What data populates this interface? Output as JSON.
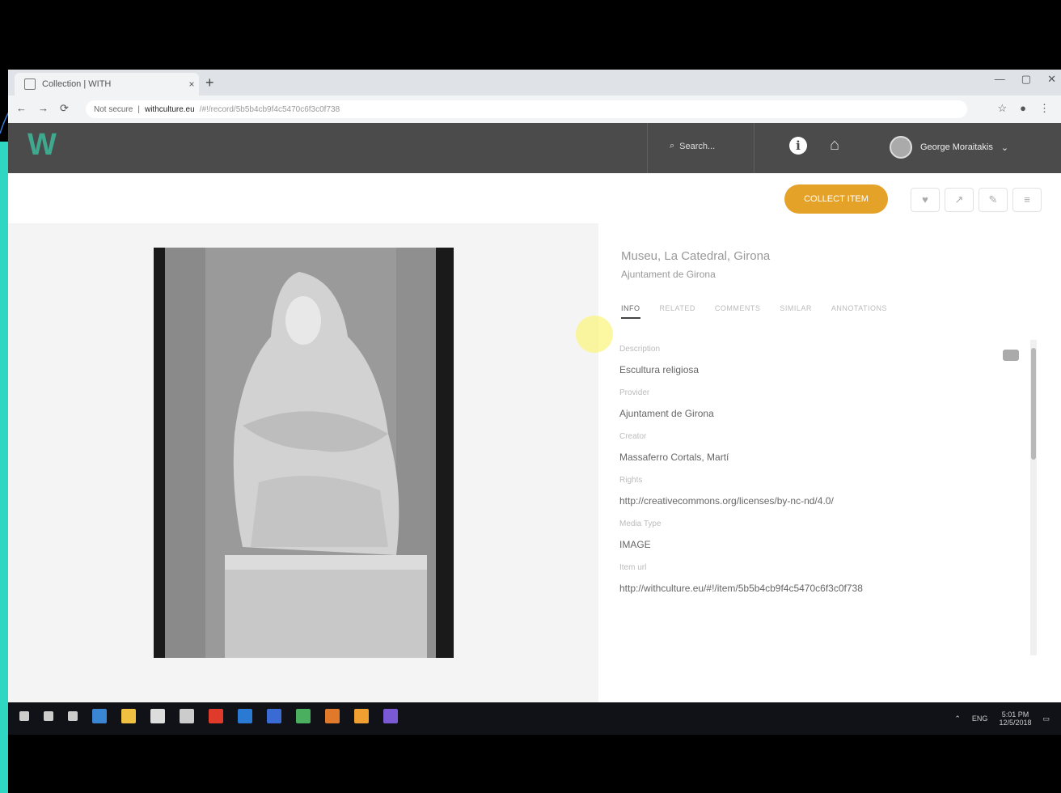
{
  "browser": {
    "tab_title": "Collection | WITH",
    "close_glyph": "×",
    "new_tab_glyph": "+",
    "window_controls": [
      "—",
      "▢",
      "✕"
    ],
    "nav": {
      "back": "←",
      "forward": "→",
      "reload": "⟳"
    },
    "security_label": "Not secure",
    "url_host": "withculture.eu",
    "url_path": "/#!/record/5b5b4cb9f4c5470c6f3c0f738"
  },
  "app": {
    "logo": "W",
    "search_placeholder": "Search...",
    "search_glyph": "⌕",
    "info_glyph": "i",
    "home_glyph": "⌂",
    "user_name": "George Moraitakis",
    "user_chevron": "⌄"
  },
  "record": {
    "collect_label": "COLLECT ITEM",
    "action_glyphs": [
      "♥",
      "↗",
      "✎",
      "≡"
    ],
    "collection": "Museu, La Catedral, Girona",
    "owner": "Ajuntament de Girona",
    "tabs": [
      "INFO",
      "RELATED",
      "COMMENTS",
      "SIMILAR",
      "ANNOTATIONS"
    ],
    "fields": [
      {
        "label": "Description",
        "value": "Escultura religiosa"
      },
      {
        "label": "Provider",
        "value": "Ajuntament de Girona"
      },
      {
        "label": "Creator",
        "value": "Massaferro Cortals, Martí"
      },
      {
        "label": "Rights",
        "value": "http://creativecommons.org/licenses/by-nc-nd/4.0/"
      },
      {
        "label": "Media Type",
        "value": "IMAGE"
      },
      {
        "label": "Item url",
        "value": "http://withculture.eu/#!/item/5b5b4cb9f4c5470c6f3c0f738"
      }
    ]
  },
  "taskbar": {
    "tray_text": "ENG",
    "time": "5:01 PM",
    "date": "12/5/2018",
    "icon_colors": [
      "#3a86d4",
      "#f0c040",
      "#ddd",
      "#cccccc",
      "#e03a2a",
      "#2a7ad4",
      "#3a6ad4",
      "#4ab060",
      "#e07a2a",
      "#f0a030",
      "#7a5ad4"
    ]
  }
}
